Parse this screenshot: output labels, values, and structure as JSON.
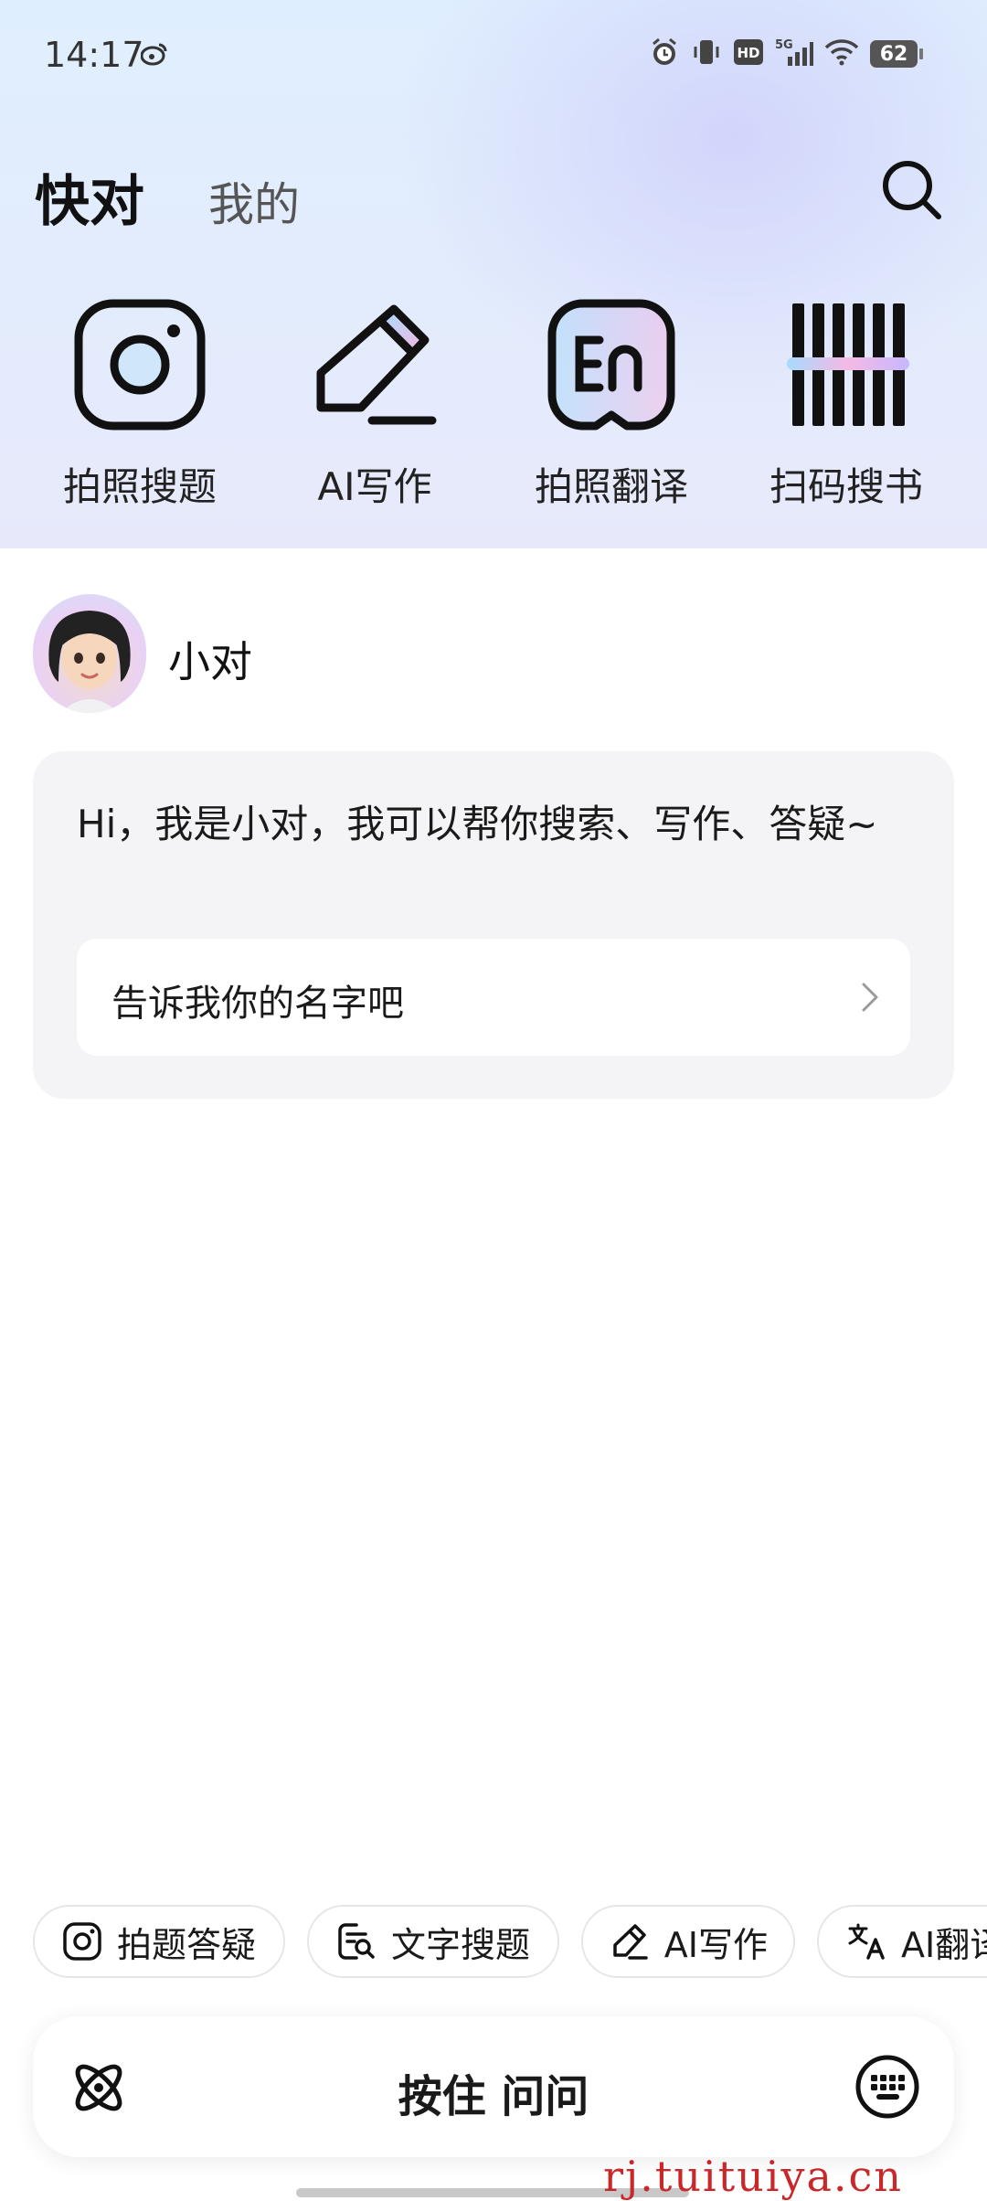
{
  "status_bar": {
    "time": "14:17",
    "battery": "62",
    "network": "5G"
  },
  "header": {
    "tab_main": "快对",
    "tab_mine": "我的"
  },
  "quick_actions": [
    {
      "label": "拍照搜题",
      "icon": "camera-icon"
    },
    {
      "label": "AI写作",
      "icon": "pencil-icon"
    },
    {
      "label": "拍照翻译",
      "icon": "translate-en-icon"
    },
    {
      "label": "扫码搜书",
      "icon": "barcode-icon"
    }
  ],
  "bot": {
    "name": "小对"
  },
  "chat": {
    "greeting": "Hi，我是小对，我可以帮你搜索、写作、答疑~",
    "suggestion": "告诉我你的名字吧"
  },
  "chips": [
    {
      "label": "拍题答疑",
      "icon": "camera-icon"
    },
    {
      "label": "文字搜题",
      "icon": "text-search-icon"
    },
    {
      "label": "AI写作",
      "icon": "pencil-icon"
    },
    {
      "label": "AI翻译",
      "icon": "translate-icon"
    }
  ],
  "input_bar": {
    "hold_label": "按住 问问"
  },
  "watermark": "rj.tuituiya.cn",
  "colors": {
    "accent_gradient": [
      "#9fd3fb",
      "#f3b6e6",
      "#c6b8ff"
    ],
    "watermark": "#c8282a"
  }
}
